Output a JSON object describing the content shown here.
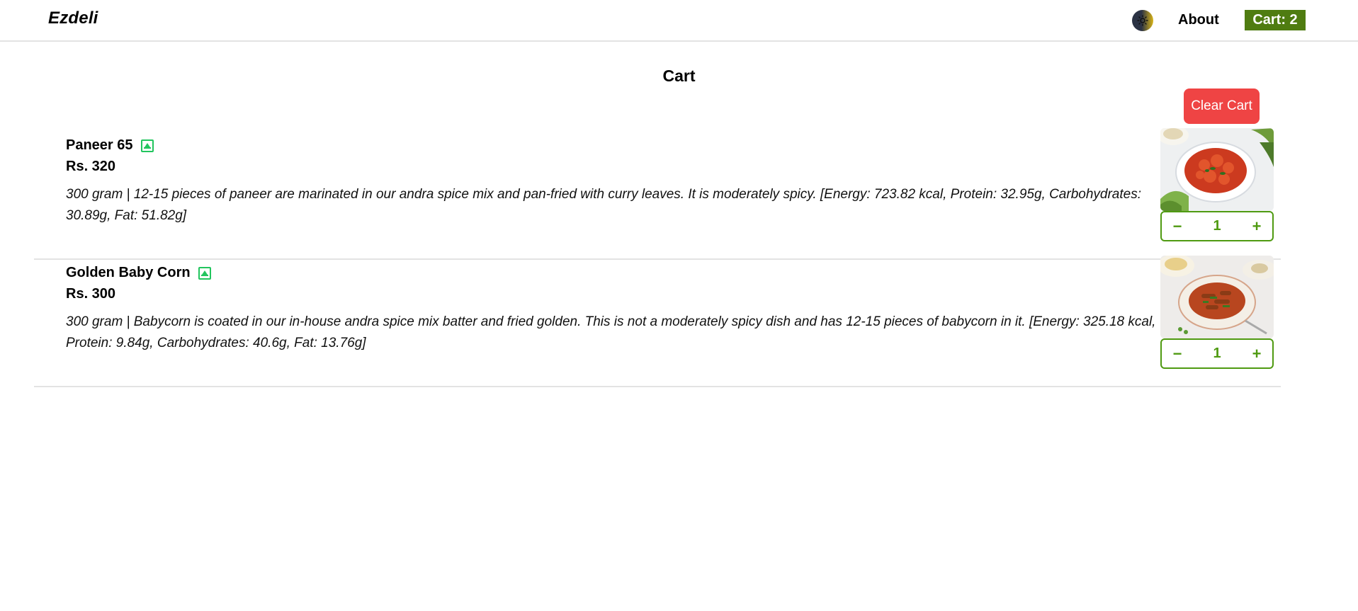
{
  "header": {
    "logo": "Ezdeli",
    "about_label": "About",
    "cart_label": "Cart: 2",
    "theme_icon": "sun-icon"
  },
  "page": {
    "title": "Cart",
    "clear_label": "Clear Cart"
  },
  "items": [
    {
      "name": "Paneer 65",
      "price": "Rs. 320",
      "description": "300 gram | 12-15 pieces of paneer are marinated in our andra spice mix and pan-fried with curry leaves. It is moderately spicy. [Energy: 723.82 kcal, Protein: 32.95g, Carbohydrates: 30.89g, Fat: 51.82g]",
      "quantity": "1",
      "minus": "−",
      "plus": "+",
      "veg_icon": "veg-indicator-icon"
    },
    {
      "name": "Golden Baby Corn",
      "price": "Rs. 300",
      "description": "300 gram | Babycorn is coated in our in-house andra spice mix batter and fried golden. This is not a moderately spicy dish and has 12-15 pieces of babycorn in it. [Energy: 325.18 kcal, Protein: 9.84g, Carbohydrates: 40.6g, Fat: 13.76g]",
      "quantity": "1",
      "minus": "−",
      "plus": "+",
      "veg_icon": "veg-indicator-icon"
    }
  ],
  "colors": {
    "accent_green": "#4f7c11",
    "clear_red": "#ef4444",
    "veg_green": "#22c55e"
  }
}
